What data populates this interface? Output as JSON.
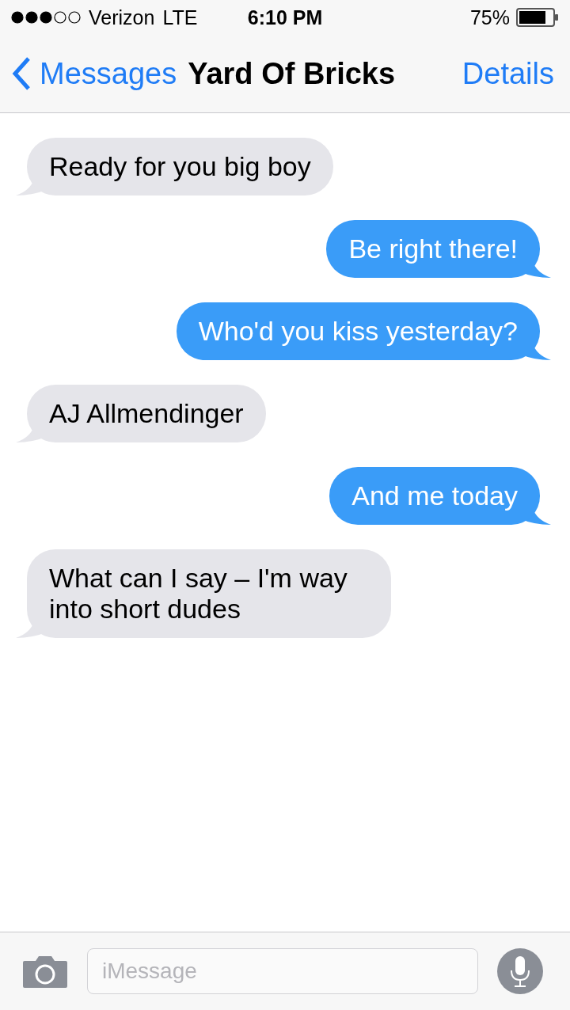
{
  "status_bar": {
    "carrier": "Verizon",
    "network": "LTE",
    "time": "6:10 PM",
    "battery": "75%"
  },
  "nav_bar": {
    "back": "Messages",
    "title": "Yard Of Bricks",
    "action": "Details"
  },
  "messages": [
    {
      "kind": "received",
      "text": "Ready for you big boy"
    },
    {
      "kind": "sent",
      "text": "Be right there!"
    },
    {
      "kind": "sent",
      "text": "Who'd you kiss yesterday?"
    },
    {
      "kind": "received",
      "text": "AJ Allmendinger"
    },
    {
      "kind": "sent",
      "text": "And me today"
    },
    {
      "kind": "received",
      "text": "What can I say – I'm way into short dudes"
    }
  ],
  "input_bar": {
    "placeholder": "iMessage"
  }
}
